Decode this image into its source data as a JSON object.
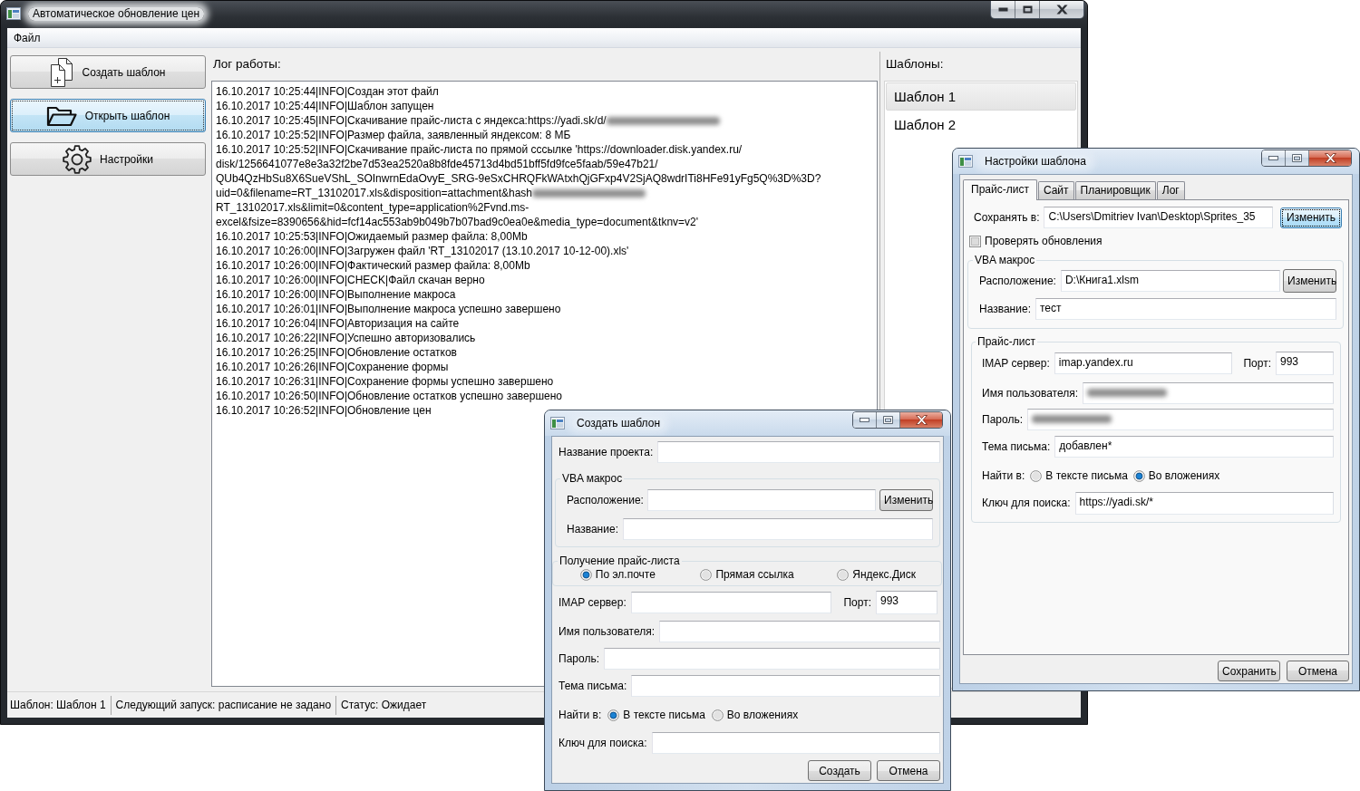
{
  "main_window": {
    "title": "Автоматическое обновление цен",
    "active": false,
    "menu": [
      "Файл"
    ],
    "actions": [
      {
        "kind": "create",
        "label": "Создать шаблон",
        "focused": false
      },
      {
        "kind": "open",
        "label": "Открыть шаблон",
        "focused": true
      },
      {
        "kind": "settings",
        "label": "Настройки",
        "focused": false
      }
    ],
    "log": {
      "label": "Лог работы:",
      "lines": [
        {
          "text": "16.10.2017 10:25:44|INFO|Создан этот файл",
          "redacted": false
        },
        {
          "text": "16.10.2017 10:25:44|INFO|Шаблон запущен",
          "redacted": false
        },
        {
          "text": "16.10.2017 10:25:45|INFO|Скачивание прайс-листа с яндекса:https://yadi.sk/d/",
          "redacted": true
        },
        {
          "text": "16.10.2017 10:25:52|INFO|Размер файла, заявленный яндексом: 8 МБ",
          "redacted": false
        },
        {
          "text": "16.10.2017 10:25:52|INFO|Скачивание прайс-листа по прямой сссылке 'https://downloader.disk.yandex.ru/",
          "redacted": false
        },
        {
          "text": "disk/1256641077e8e3a32f2be7d53ea2520a8b8fde45713d4bd51bff5fd9fce5faab/59e47b21/",
          "redacted": false
        },
        {
          "text": "QUb4QzHbSu8X6SueVShL_SOInwrnEdaOvyE_SRG-9eSxCHRQFkWAtxhQjGFxp4V2SjAQ8wdrITi8HFe91yFg5Q%3D%3D?",
          "redacted": false
        },
        {
          "text": "uid=0&filename=RT_13102017.xls&disposition=attachment&hash",
          "redacted": true
        },
        {
          "text": "RT_13102017.xls&limit=0&content_type=application%2Fvnd.ms-",
          "redacted": false
        },
        {
          "text": "excel&fsize=8390656&hid=fcf14ac553ab9b049b7b07bad9c0ea0e&media_type=document&tknv=v2'",
          "redacted": false
        },
        {
          "text": "16.10.2017 10:25:53|INFO|Ожидаемый размер файла: 8,00Mb",
          "redacted": false
        },
        {
          "text": "16.10.2017 10:26:00|INFO|Загружен файл 'RT_13102017 (13.10.2017 10-12-00).xls'",
          "redacted": false
        },
        {
          "text": "16.10.2017 10:26:00|INFO|Фактический размер файла: 8,00Mb",
          "redacted": false
        },
        {
          "text": "16.10.2017 10:26:00|INFO|CHECK|Файл скачан верно",
          "redacted": false
        },
        {
          "text": "16.10.2017 10:26:00|INFO|Выполнение макроса",
          "redacted": false
        },
        {
          "text": "16.10.2017 10:26:01|INFO|Выполнение макроса успешно завершено",
          "redacted": false
        },
        {
          "text": "16.10.2017 10:26:04|INFO|Авторизация на сайте",
          "redacted": false
        },
        {
          "text": "16.10.2017 10:26:22|INFO|Успешно авторизовались",
          "redacted": false
        },
        {
          "text": "16.10.2017 10:26:25|INFO|Обновление остатков",
          "redacted": false
        },
        {
          "text": "16.10.2017 10:26:26|INFO|Сохранение формы",
          "redacted": false
        },
        {
          "text": "16.10.2017 10:26:31|INFO|Сохранение формы успешно завершено",
          "redacted": false
        },
        {
          "text": "16.10.2017 10:26:50|INFO|Обновление остатков успешно завершено",
          "redacted": false
        },
        {
          "text": "16.10.2017 10:26:52|INFO|Обновление цен",
          "redacted": false
        }
      ]
    },
    "templates": {
      "label": "Шаблоны:",
      "items": [
        {
          "label": "Шаблон 1",
          "selected": true
        },
        {
          "label": "Шаблон 2",
          "selected": false
        }
      ]
    },
    "status_bar": [
      "Шаблон: Шаблон 1",
      "Следующий запуск: расписание не задано",
      "Статус: Ожидает"
    ]
  },
  "settings_dialog": {
    "title": "Настройки шаблона",
    "active": true,
    "tabs": [
      {
        "label": "Прайс-лист",
        "selected": true
      },
      {
        "label": "Сайт",
        "selected": false
      },
      {
        "label": "Планировщик",
        "selected": false
      },
      {
        "label": "Лог",
        "selected": false
      }
    ],
    "save_to": {
      "label": "Сохранять в:",
      "value": "C:\\Users\\Dmitriev Ivan\\Desktop\\Sprites_35",
      "button": {
        "label": "Изменить",
        "focused": true
      }
    },
    "check_updates": {
      "label": "Проверять обновления",
      "checked": false
    },
    "vba_group": {
      "title": "VBA макрос",
      "location": {
        "label": "Расположение:",
        "value": "D:\\Книга1.xlsm",
        "button": {
          "label": "Изменить",
          "focused": false
        }
      },
      "name": {
        "label": "Название:",
        "value": "тест"
      }
    },
    "price_group": {
      "title": "Прайс-лист",
      "imap_server": {
        "label": "IMAP сервер:",
        "value": "imap.yandex.ru"
      },
      "port": {
        "label": "Порт:",
        "value": "993"
      },
      "username": {
        "label": "Имя пользователя:",
        "redacted": true
      },
      "password": {
        "label": "Пароль:",
        "redacted": true
      },
      "subject": {
        "label": "Тема письма:",
        "value": "добавлен*"
      },
      "find_in": {
        "label": "Найти в:",
        "options": [
          {
            "label": "В тексте письма",
            "selected": false
          },
          {
            "label": "Во вложениях",
            "selected": true
          }
        ]
      },
      "search_key": {
        "label": "Ключ для поиска:",
        "value": "https://yadi.sk/*"
      }
    },
    "buttons": [
      "Сохранить",
      "Отмена"
    ]
  },
  "create_dialog": {
    "title": "Создать шаблон",
    "active": true,
    "project_name": {
      "label": "Название проекта:"
    },
    "vba_group": {
      "title": "VBA макрос",
      "location": {
        "label": "Расположение:",
        "button": {
          "label": "Изменить",
          "focused": false
        }
      },
      "name": {
        "label": "Название:"
      }
    },
    "source_group": {
      "title": "Получение прайс-листа",
      "options": [
        {
          "label": "По эл.почте",
          "selected": true
        },
        {
          "label": "Прямая ссылка",
          "selected": false
        },
        {
          "label": "Яндекс.Диск",
          "selected": false
        }
      ]
    },
    "imap_server": {
      "label": "IMAP сервер:"
    },
    "port": {
      "label": "Порт:",
      "value": "993"
    },
    "username": {
      "label": "Имя пользователя:"
    },
    "password": {
      "label": "Пароль:"
    },
    "subject": {
      "label": "Тема письма:"
    },
    "find_in": {
      "label": "Найти в:",
      "options": [
        {
          "label": "В тексте письма",
          "selected": true
        },
        {
          "label": "Во вложениях",
          "selected": false
        }
      ]
    },
    "search_key": {
      "label": "Ключ для поиска:"
    },
    "buttons": [
      "Создать",
      "Отмена"
    ]
  }
}
